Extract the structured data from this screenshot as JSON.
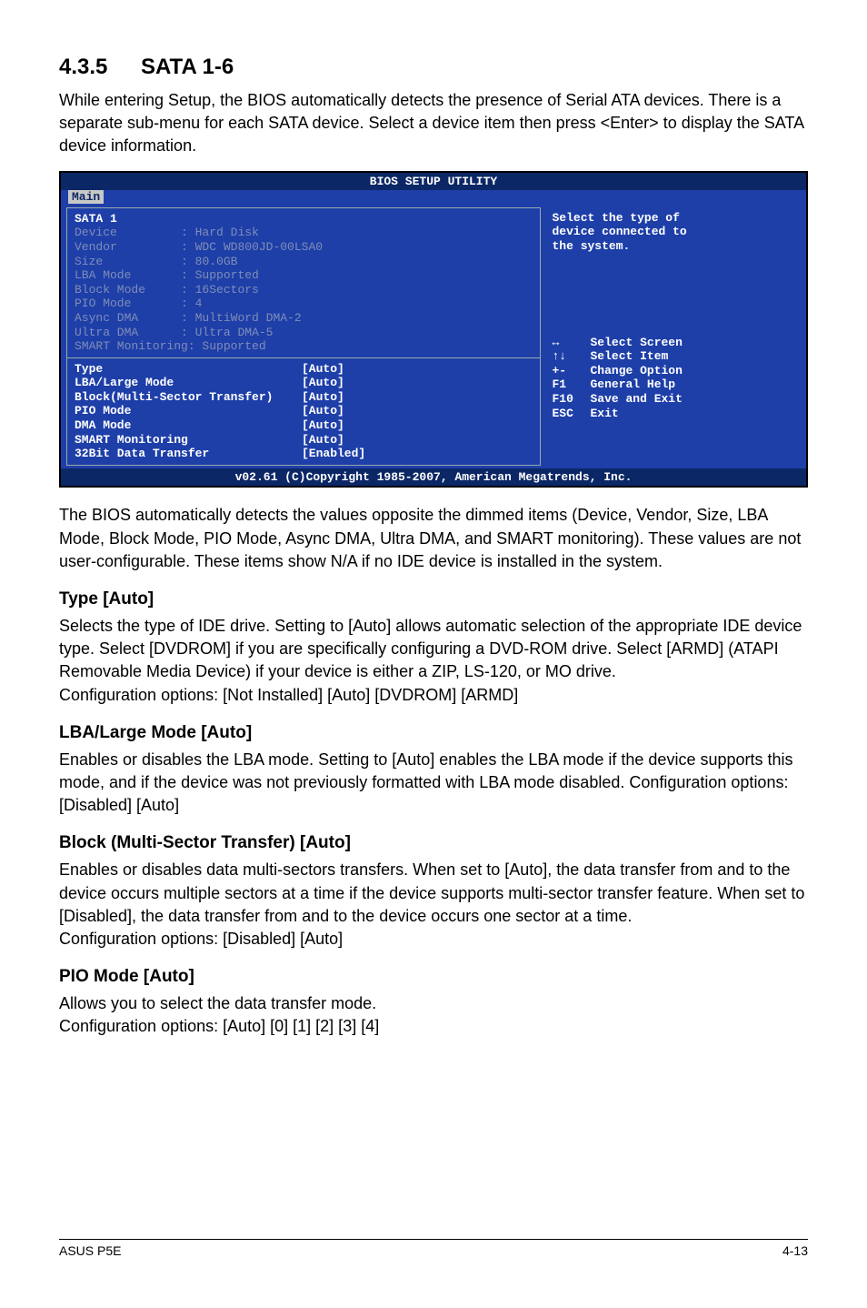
{
  "section": {
    "number": "4.3.5",
    "title": "SATA 1-6"
  },
  "intro": "While entering Setup, the BIOS automatically detects the presence of Serial ATA devices. There is a separate sub-menu for each SATA device. Select a device item then press <Enter> to display the SATA device information.",
  "bios": {
    "title": "BIOS SETUP UTILITY",
    "tab": "Main",
    "heading": "SATA 1",
    "info": [
      {
        "k": "Device",
        "v": ": Hard Disk"
      },
      {
        "k": "Vendor",
        "v": ": WDC WD800JD-00LSA0"
      },
      {
        "k": "Size",
        "v": ": 80.0GB"
      },
      {
        "k": "LBA Mode",
        "v": ": Supported"
      },
      {
        "k": "Block Mode",
        "v": ": 16Sectors"
      },
      {
        "k": "PIO Mode",
        "v": ": 4"
      },
      {
        "k": "Async DMA",
        "v": ": MultiWord DMA-2"
      },
      {
        "k": "Ultra DMA",
        "v": ": Ultra DMA-5"
      },
      {
        "k": "SMART Monitoring",
        "v": ": Supported"
      }
    ],
    "settings": [
      {
        "label": "Type",
        "value": "[Auto]"
      },
      {
        "label": "LBA/Large Mode",
        "value": "[Auto]"
      },
      {
        "label": "Block(Multi-Sector Transfer)",
        "value": "[Auto]"
      },
      {
        "label": "PIO Mode",
        "value": "[Auto]"
      },
      {
        "label": "DMA Mode",
        "value": "[Auto]"
      },
      {
        "label": "SMART Monitoring",
        "value": "[Auto]"
      },
      {
        "label": "32Bit Data Transfer",
        "value": "[Enabled]"
      }
    ],
    "help": {
      "desc1": "Select the type of",
      "desc2": "device connected to",
      "desc3": "the system.",
      "keys": [
        {
          "icon": "↔",
          "text": "Select Screen"
        },
        {
          "icon": "↑↓",
          "text": "Select Item"
        },
        {
          "icon": "+-",
          "text": "Change Option"
        },
        {
          "icon": "F1",
          "text": "General Help"
        },
        {
          "icon": "F10",
          "text": "Save and Exit"
        },
        {
          "icon": "ESC",
          "text": "Exit"
        }
      ]
    },
    "footer": "v02.61 (C)Copyright 1985-2007, American Megatrends, Inc."
  },
  "body1": "The BIOS automatically detects the values opposite the dimmed items (Device, Vendor, Size, LBA Mode, Block Mode, PIO Mode, Async DMA, Ultra DMA, and SMART monitoring). These values are not user-configurable. These items show N/A if no IDE device is installed in the system.",
  "type_h": "Type [Auto]",
  "type_p": "Selects the type of IDE drive. Setting to [Auto] allows automatic selection of the appropriate IDE device type. Select [DVDROM] if you are specifically configuring a DVD-ROM drive. Select [ARMD] (ATAPI Removable Media Device) if your device is either a ZIP, LS-120, or MO drive.",
  "type_cfg": "Configuration options: [Not Installed] [Auto] [DVDROM] [ARMD]",
  "lba_h": "LBA/Large Mode [Auto]",
  "lba_p": "Enables or disables the LBA mode. Setting to [Auto] enables the LBA mode if the device supports this mode, and if the device was not previously formatted with LBA mode disabled. Configuration options: [Disabled] [Auto]",
  "block_h": "Block (Multi-Sector Transfer) [Auto]",
  "block_p": "Enables or disables data multi-sectors transfers. When set to [Auto], the data transfer from and to the device occurs multiple sectors at a time if the device supports multi-sector transfer feature. When set to [Disabled], the data transfer from and to the device occurs one sector at a time.",
  "block_cfg": "Configuration options: [Disabled] [Auto]",
  "pio_h": "PIO Mode [Auto]",
  "pio_p": "Allows you to select the data transfer mode.",
  "pio_cfg": "Configuration options: [Auto] [0] [1] [2] [3] [4]",
  "footer_left": "ASUS P5E",
  "footer_right": "4-13"
}
